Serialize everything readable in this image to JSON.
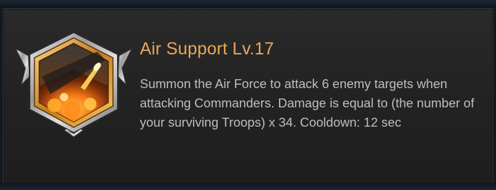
{
  "skill": {
    "icon": "air-support-skill-icon",
    "title": "Air Support Lv.17",
    "description": "Summon the Air Force to attack 6 enemy targets when attacking Commanders. Damage is equal to (the number of your surviving Troops) x 34. Cooldown: 12 sec"
  },
  "colors": {
    "title": "#e8a85a",
    "description": "#bfbfbf",
    "panel": "#262626"
  }
}
